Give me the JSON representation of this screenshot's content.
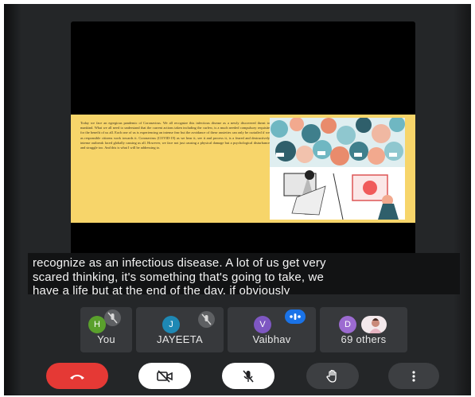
{
  "presentation": {
    "slide_text": "Today we face an egregious pandemic of Coronavirus. We all recognize this infectious disease as a newly discovered threat to mankind. What we all need to understand that the current actions taken including the curfew, is a much needed compulsory requisite for the benefit of us all. Each one of us is experiencing an intense fear but the avoidance of these anxieties can only be curtailed if we as responsible citizens work towards it. Coronavirus (COVID-19) as we hear it, see it and process it, is a feared and destructively intense outbreak faced globally causing us all. However, we face not just causing a physical damage but a psychological disturbance and struggle too. And this is what I will be addressing to."
  },
  "captions": {
    "line1": "recognize as an infectious disease. A lot of us get very",
    "line2": "scared thinking, it's something that's going to take, we",
    "line3": "have a life but at the end of the day, if obviously"
  },
  "participants": [
    {
      "initial": "H",
      "name": "You",
      "color": "#5aa02c"
    },
    {
      "initial": "J",
      "name": "JAYEETA",
      "color": "#1e88b4"
    },
    {
      "initial": "V",
      "name": "Vaibhav",
      "color": "#7e57c2"
    },
    {
      "initial": "D",
      "name": "69 others",
      "color": "#9c6bd1"
    }
  ],
  "colors": {
    "end_call": "#e53935",
    "speaking": "#1a73e8",
    "slide_bg": "#f7d56a"
  },
  "controls": {
    "end": "phone-hangup-icon",
    "camera": "camera-off-icon",
    "mic": "mic-off-icon",
    "hand": "raise-hand-icon",
    "more": "more-vert-icon"
  }
}
